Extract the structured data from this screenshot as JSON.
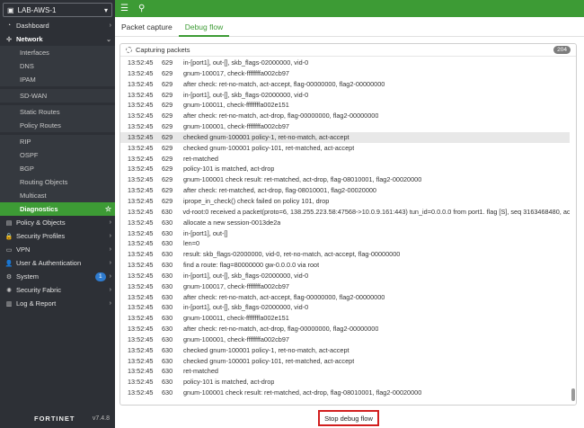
{
  "device": {
    "name": "LAB-AWS-1"
  },
  "nav": [
    {
      "label": "Dashboard",
      "icon": "dashboard-icon",
      "glyph": "◔",
      "type": "item",
      "chevron": true
    },
    {
      "label": "Network",
      "icon": "network-icon",
      "glyph": "✣",
      "type": "group",
      "chevron": "down"
    },
    {
      "label": "Interfaces",
      "type": "sub"
    },
    {
      "label": "DNS",
      "type": "sub"
    },
    {
      "label": "IPAM",
      "type": "sub"
    },
    {
      "label": "SD-WAN",
      "type": "sub",
      "gap": true
    },
    {
      "label": "Static Routes",
      "type": "sub",
      "gap": true
    },
    {
      "label": "Policy Routes",
      "type": "sub"
    },
    {
      "label": "RIP",
      "type": "sub",
      "gap": true
    },
    {
      "label": "OSPF",
      "type": "sub"
    },
    {
      "label": "BGP",
      "type": "sub"
    },
    {
      "label": "Routing Objects",
      "type": "sub"
    },
    {
      "label": "Multicast",
      "type": "sub"
    },
    {
      "label": "Diagnostics",
      "type": "active"
    },
    {
      "label": "Policy & Objects",
      "icon": "policy-icon",
      "glyph": "▤",
      "type": "item",
      "chevron": true
    },
    {
      "label": "Security Profiles",
      "icon": "lock-icon",
      "glyph": "🔒",
      "type": "item",
      "chevron": true
    },
    {
      "label": "VPN",
      "icon": "vpn-icon",
      "glyph": "▭",
      "type": "item",
      "chevron": true
    },
    {
      "label": "User & Authentication",
      "icon": "user-icon",
      "glyph": "👤",
      "type": "item",
      "chevron": true
    },
    {
      "label": "System",
      "icon": "gear-icon",
      "glyph": "⚙",
      "type": "item",
      "chevron": true,
      "badge": "1"
    },
    {
      "label": "Security Fabric",
      "icon": "fabric-icon",
      "glyph": "✺",
      "type": "item",
      "chevron": true
    },
    {
      "label": "Log & Report",
      "icon": "report-icon",
      "glyph": "▥",
      "type": "item",
      "chevron": true
    }
  ],
  "footer": {
    "logo": "FORTINET",
    "version": "v7.4.8"
  },
  "tabs": [
    {
      "label": "Packet capture",
      "active": false
    },
    {
      "label": "Debug flow",
      "active": true
    }
  ],
  "capture": {
    "title": "Capturing packets",
    "count": "204"
  },
  "log": [
    {
      "t": "13:52:45",
      "n": "629",
      "m": "in-[port1], out-[], skb_flags-02000000, vid-0"
    },
    {
      "t": "13:52:45",
      "n": "629",
      "m": "gnum-100017, check-ffffffffa002cb97"
    },
    {
      "t": "13:52:45",
      "n": "629",
      "m": "after check: ret-no-match, act-accept, flag-00000000, flag2-00000000"
    },
    {
      "t": "13:52:45",
      "n": "629",
      "m": "in-[port1], out-[], skb_flags-02000000, vid-0"
    },
    {
      "t": "13:52:45",
      "n": "629",
      "m": "gnum-100011, check-ffffffffa002e151"
    },
    {
      "t": "13:52:45",
      "n": "629",
      "m": "after check: ret-no-match, act-drop, flag-00000000, flag2-00000000"
    },
    {
      "t": "13:52:45",
      "n": "629",
      "m": "gnum-100001, check-ffffffffa002cb97"
    },
    {
      "t": "13:52:45",
      "n": "629",
      "m": "checked gnum-100001 policy-1, ret-no-match, act-accept",
      "hl": true
    },
    {
      "t": "13:52:45",
      "n": "629",
      "m": "checked gnum-100001 policy-101, ret-matched, act-accept"
    },
    {
      "t": "13:52:45",
      "n": "629",
      "m": "ret-matched"
    },
    {
      "t": "13:52:45",
      "n": "629",
      "m": "policy-101 is matched, act-drop"
    },
    {
      "t": "13:52:45",
      "n": "629",
      "m": "gnum-100001 check result: ret-matched, act-drop, flag-08010001, flag2-00020000"
    },
    {
      "t": "13:52:45",
      "n": "629",
      "m": "after check: ret-matched, act-drop, flag-08010001, flag2-00020000"
    },
    {
      "t": "13:52:45",
      "n": "629",
      "m": "iprope_in_check() check failed on policy 101, drop"
    },
    {
      "t": "13:52:45",
      "n": "630",
      "m": "vd-root:0 received a packet(proto=6, 138.255.223.58:47568->10.0.9.161:443) tun_id=0.0.0.0 from port1. flag [S], seq 3163468480, ack"
    },
    {
      "t": "13:52:45",
      "n": "630",
      "m": "allocate a new session-0013de2a"
    },
    {
      "t": "13:52:45",
      "n": "630",
      "m": "in-[port1], out-[]"
    },
    {
      "t": "13:52:45",
      "n": "630",
      "m": "len=0"
    },
    {
      "t": "13:52:45",
      "n": "630",
      "m": "result: skb_flags-02000000, vid-0, ret-no-match, act-accept, flag-00000000"
    },
    {
      "t": "13:52:45",
      "n": "630",
      "m": "find a route: flag=80000000 gw-0.0.0.0 via root"
    },
    {
      "t": "13:52:45",
      "n": "630",
      "m": "in-[port1], out-[], skb_flags-02000000, vid-0"
    },
    {
      "t": "13:52:45",
      "n": "630",
      "m": "gnum-100017, check-ffffffffa002cb97"
    },
    {
      "t": "13:52:45",
      "n": "630",
      "m": "after check: ret-no-match, act-accept, flag-00000000, flag2-00000000"
    },
    {
      "t": "13:52:45",
      "n": "630",
      "m": "in-[port1], out-[], skb_flags-02000000, vid-0"
    },
    {
      "t": "13:52:45",
      "n": "630",
      "m": "gnum-100011, check-ffffffffa002e151"
    },
    {
      "t": "13:52:45",
      "n": "630",
      "m": "after check: ret-no-match, act-drop, flag-00000000, flag2-00000000"
    },
    {
      "t": "13:52:45",
      "n": "630",
      "m": "gnum-100001, check-ffffffffa002cb97"
    },
    {
      "t": "13:52:45",
      "n": "630",
      "m": "checked gnum-100001 policy-1, ret-no-match, act-accept"
    },
    {
      "t": "13:52:45",
      "n": "630",
      "m": "checked gnum-100001 policy-101, ret-matched, act-accept"
    },
    {
      "t": "13:52:45",
      "n": "630",
      "m": "ret-matched"
    },
    {
      "t": "13:52:45",
      "n": "630",
      "m": "policy-101 is matched, act-drop"
    },
    {
      "t": "13:52:45",
      "n": "630",
      "m": "gnum-100001 check result: ret-matched, act-drop, flag-08010001, flag2-00020000"
    }
  ],
  "stop_button": {
    "label": "Stop debug flow"
  },
  "colors": {
    "accent": "#3d9b35",
    "sidebar": "#2d3036",
    "danger": "#d21f1f"
  }
}
